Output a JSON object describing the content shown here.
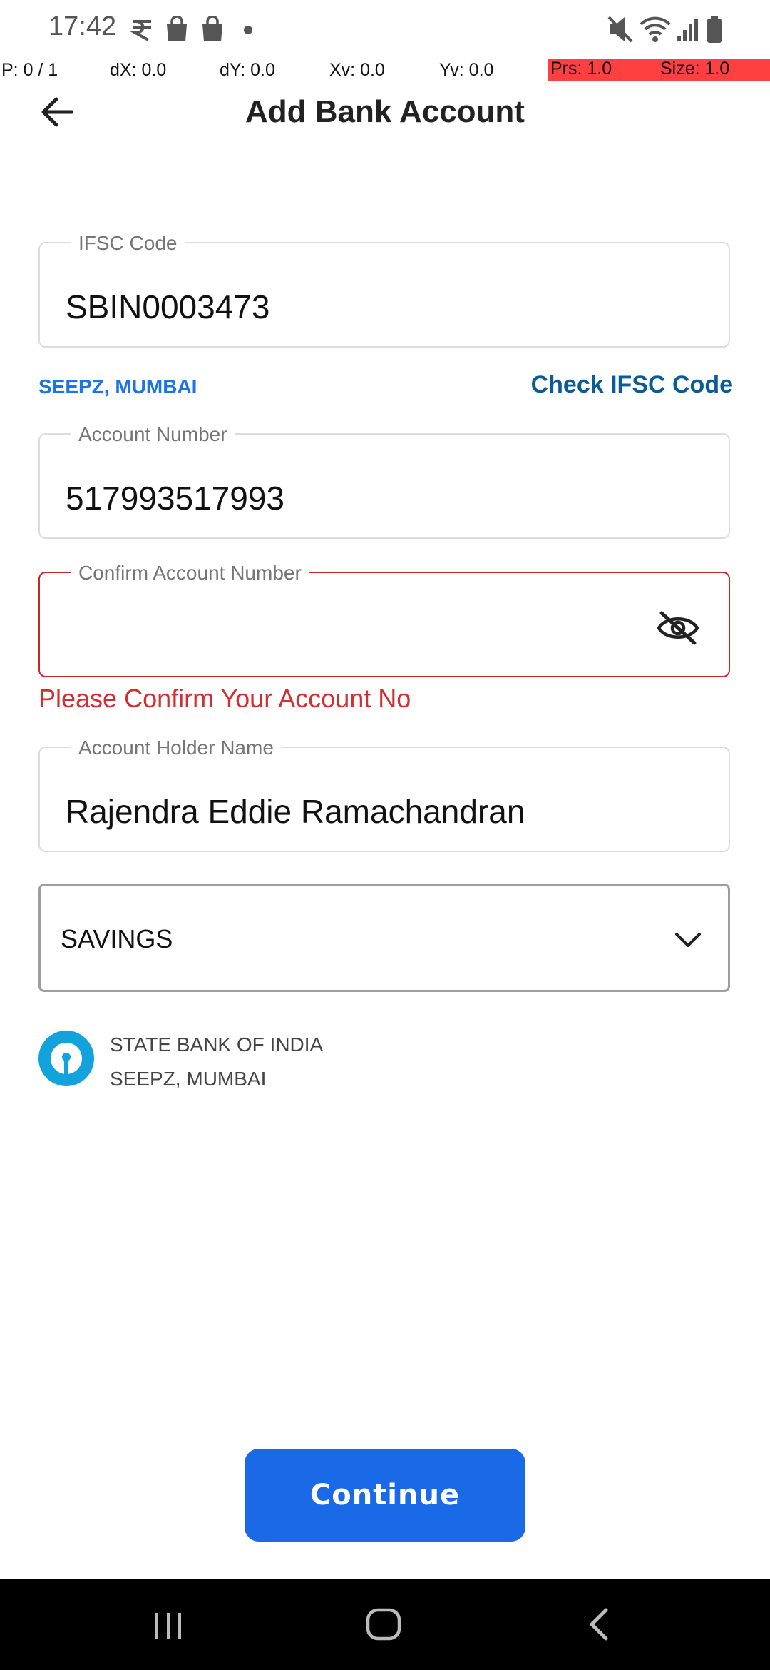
{
  "status_bar": {
    "time": "17:42",
    "left_icons": [
      "rupee-notification-icon",
      "shopping-bag-icon",
      "shopping-bag-icon",
      "dot-icon"
    ],
    "right_icons": [
      "mute-icon",
      "wifi-icon",
      "signal-icon",
      "battery-icon"
    ]
  },
  "pointer_overlay": {
    "p": "P: 0 / 1",
    "dx": "dX: 0.0",
    "dy": "dY: 0.0",
    "xv": "Xv: 0.0",
    "yv": "Yv: 0.0",
    "prs": "Prs: 1.0",
    "size": "Size: 1.0"
  },
  "header": {
    "title": "Add Bank Account"
  },
  "form": {
    "ifsc": {
      "label": "IFSC Code",
      "value": "SBIN0003473"
    },
    "branch_hint": "SEEPZ, MUMBAI",
    "check_ifsc_link": "Check IFSC Code",
    "account_number": {
      "label": "Account Number",
      "value": "517993517993"
    },
    "confirm_account_number": {
      "label": "Confirm Account Number",
      "value": "",
      "error": "Please Confirm Your Account No"
    },
    "account_holder_name": {
      "label": "Account Holder Name",
      "value": "Rajendra Eddie Ramachandran"
    },
    "account_type": {
      "selected": "SAVINGS"
    }
  },
  "bank_info": {
    "name": "STATE BANK OF INDIA",
    "branch": "SEEPZ, MUMBAI"
  },
  "continue_label": "Continue",
  "colors": {
    "accent": "#1a6ae8",
    "link": "#0b5c96",
    "error": "#d32f2f",
    "sbi_logo": "#13a3dc"
  }
}
